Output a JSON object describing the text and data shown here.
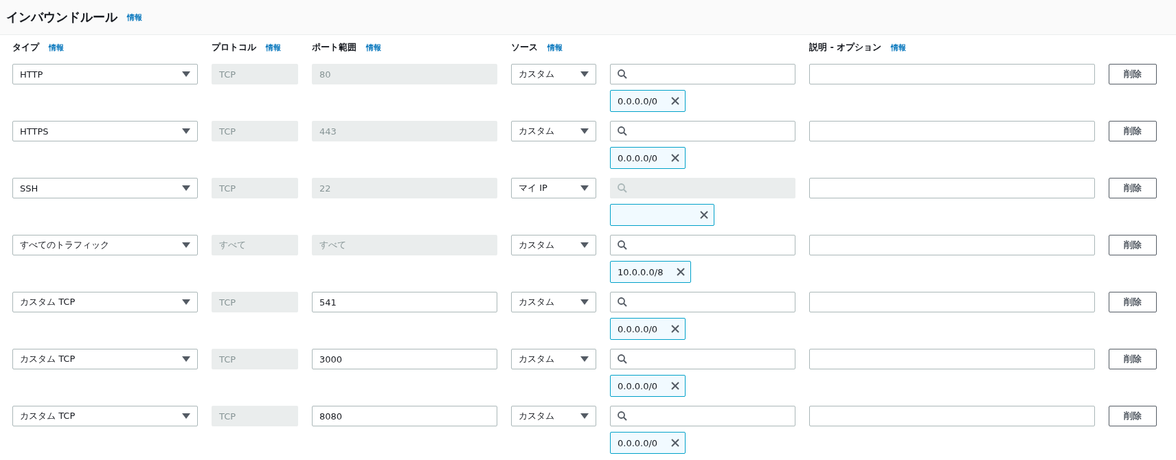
{
  "header": {
    "title": "インバウンドルール",
    "info": "情報"
  },
  "columns": [
    {
      "label": "タイプ",
      "info": "情報"
    },
    {
      "label": "プロトコル",
      "info": "情報"
    },
    {
      "label": "ポート範囲",
      "info": "情報"
    },
    {
      "label": "ソース",
      "info": "情報"
    },
    {
      "label": "説明 - オプション",
      "info": "情報"
    }
  ],
  "rules": [
    {
      "type": "HTTP",
      "protocol": "TCP",
      "protocol_disabled": true,
      "port": "80",
      "port_disabled": true,
      "source": "カスタム",
      "search_disabled": false,
      "token": {
        "value": "0.0.0.0/0"
      },
      "delete": "削除"
    },
    {
      "type": "HTTPS",
      "protocol": "TCP",
      "protocol_disabled": true,
      "port": "443",
      "port_disabled": true,
      "source": "カスタム",
      "search_disabled": false,
      "token": {
        "value": "0.0.0.0/0"
      },
      "delete": "削除"
    },
    {
      "type": "SSH",
      "protocol": "TCP",
      "protocol_disabled": true,
      "port": "22",
      "port_disabled": true,
      "source": "マイ IP",
      "search_disabled": true,
      "token_shown": true,
      "delete": "削除"
    },
    {
      "type": "すべてのトラフィック",
      "protocol": "すべて",
      "protocol_disabled": true,
      "port": "すべて",
      "port_disabled": true,
      "source": "カスタム",
      "search_disabled": false,
      "token": {
        "value": "10.0.0.0/8"
      },
      "delete": "削除"
    },
    {
      "type": "カスタム TCP",
      "protocol": "TCP",
      "protocol_disabled": true,
      "port": "541",
      "port_disabled": false,
      "source": "カスタム",
      "search_disabled": false,
      "token": {
        "value": "0.0.0.0/0"
      },
      "delete": "削除"
    },
    {
      "type": "カスタム TCP",
      "protocol": "TCP",
      "protocol_disabled": true,
      "port": "3000",
      "port_disabled": false,
      "source": "カスタム",
      "search_disabled": false,
      "token": {
        "value": "0.0.0.0/0"
      },
      "delete": "削除"
    },
    {
      "type": "カスタム TCP",
      "protocol": "TCP",
      "protocol_disabled": true,
      "port": "8080",
      "port_disabled": false,
      "source": "カスタム",
      "search_disabled": false,
      "token": {
        "value": "0.0.0.0/0"
      },
      "delete": "削除"
    }
  ]
}
